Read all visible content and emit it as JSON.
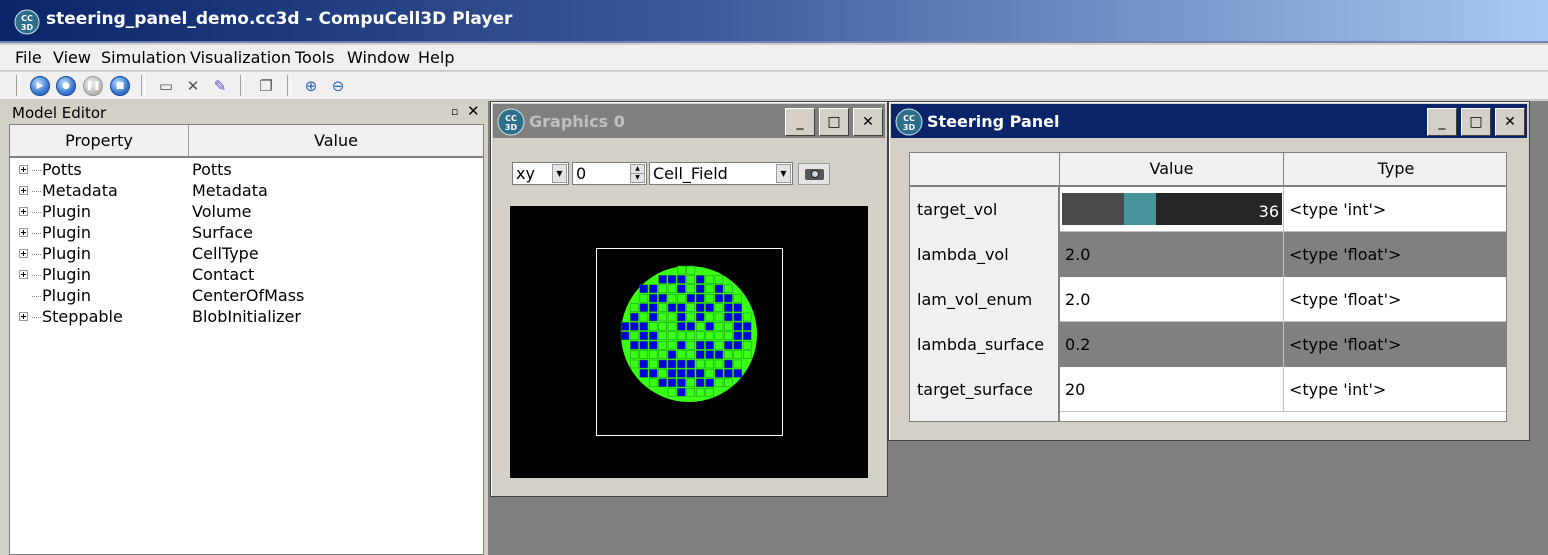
{
  "window": {
    "title": "steering_panel_demo.cc3d - CompuCell3D Player",
    "logo_text": "CC3D"
  },
  "menu": [
    "File",
    "View",
    "Simulation",
    "Visualization",
    "Tools",
    "Window",
    "Help"
  ],
  "toolbar": {
    "buttons": [
      "run-icon",
      "step-icon",
      "pause-icon",
      "stop-icon",
      "open-folder-icon",
      "tools-icon",
      "edit-icon",
      "windows-icon",
      "zoom-in-icon",
      "zoom-out-icon"
    ]
  },
  "model_editor": {
    "title": "Model Editor",
    "float_glyph": "▫",
    "close_glyph": "✕",
    "columns": [
      "Property",
      "Value"
    ],
    "rows": [
      {
        "property": "Potts",
        "value": "Potts",
        "expandable": true
      },
      {
        "property": "Metadata",
        "value": "Metadata",
        "expandable": true
      },
      {
        "property": "Plugin",
        "value": "Volume",
        "expandable": true
      },
      {
        "property": "Plugin",
        "value": "Surface",
        "expandable": true
      },
      {
        "property": "Plugin",
        "value": "CellType",
        "expandable": true
      },
      {
        "property": "Plugin",
        "value": "Contact",
        "expandable": true
      },
      {
        "property": "Plugin",
        "value": "CenterOfMass",
        "expandable": false
      },
      {
        "property": "Steppable",
        "value": "BlobInitializer",
        "expandable": true
      }
    ]
  },
  "graphics_window": {
    "title": "Graphics 0",
    "plane": "xy",
    "position": "0",
    "field": "Cell_Field",
    "minimize_glyph": "_",
    "maximize_glyph": "□",
    "close_glyph": "✕"
  },
  "steering_panel": {
    "title": "Steering Panel",
    "columns": [
      "Value",
      "Type"
    ],
    "minimize_glyph": "_",
    "maximize_glyph": "□",
    "close_glyph": "✕",
    "rows": [
      {
        "name": "target_vol",
        "value": "36",
        "type": "<type 'int'>",
        "widget": "slider",
        "slider_fraction": 0.33
      },
      {
        "name": "lambda_vol",
        "value": "2.0",
        "type": "<type 'float'>",
        "widget": "text"
      },
      {
        "name": "lam_vol_enum",
        "value": "2.0",
        "type": "<type 'float'>",
        "widget": "text"
      },
      {
        "name": "lambda_surface",
        "value": "0.2",
        "type": "<type 'float'>",
        "widget": "text"
      },
      {
        "name": "target_surface",
        "value": "20",
        "type": "<type 'int'>",
        "widget": "text"
      }
    ]
  },
  "colors": {
    "cell_green": "#39ff14",
    "cell_blue": "#0000e0",
    "active_title": "#0a246a",
    "inactive_title": "#808080",
    "slider_handle": "#47949c"
  }
}
